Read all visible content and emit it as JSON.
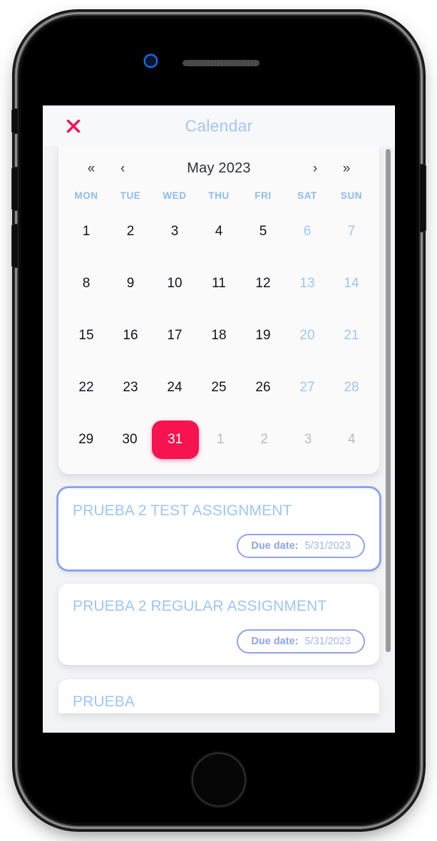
{
  "app": {
    "title": "Calendar",
    "close_icon": "close-x-icon",
    "accent_pink": "#f6134f",
    "accent_blue": "#9dc6f6",
    "accent_periwinkle": "#8ea4ee"
  },
  "calendar": {
    "month_label": "May 2023",
    "nav": {
      "prev_year": "«",
      "prev_month": "‹",
      "next_month": "›",
      "next_year": "»"
    },
    "weekdays": [
      "MON",
      "TUE",
      "WED",
      "THU",
      "FRI",
      "SAT",
      "SUN"
    ],
    "weeks": [
      [
        {
          "day": "1",
          "kind": "weekday"
        },
        {
          "day": "2",
          "kind": "weekday"
        },
        {
          "day": "3",
          "kind": "weekday"
        },
        {
          "day": "4",
          "kind": "weekday"
        },
        {
          "day": "5",
          "kind": "weekday"
        },
        {
          "day": "6",
          "kind": "weekend"
        },
        {
          "day": "7",
          "kind": "weekend"
        }
      ],
      [
        {
          "day": "8",
          "kind": "weekday"
        },
        {
          "day": "9",
          "kind": "weekday"
        },
        {
          "day": "10",
          "kind": "weekday"
        },
        {
          "day": "11",
          "kind": "weekday"
        },
        {
          "day": "12",
          "kind": "weekday"
        },
        {
          "day": "13",
          "kind": "weekend"
        },
        {
          "day": "14",
          "kind": "weekend"
        }
      ],
      [
        {
          "day": "15",
          "kind": "weekday"
        },
        {
          "day": "16",
          "kind": "weekday"
        },
        {
          "day": "17",
          "kind": "weekday"
        },
        {
          "day": "18",
          "kind": "weekday"
        },
        {
          "day": "19",
          "kind": "weekday"
        },
        {
          "day": "20",
          "kind": "weekend"
        },
        {
          "day": "21",
          "kind": "weekend"
        }
      ],
      [
        {
          "day": "22",
          "kind": "weekday"
        },
        {
          "day": "23",
          "kind": "weekday"
        },
        {
          "day": "24",
          "kind": "weekday"
        },
        {
          "day": "25",
          "kind": "weekday"
        },
        {
          "day": "26",
          "kind": "weekday"
        },
        {
          "day": "27",
          "kind": "weekend"
        },
        {
          "day": "28",
          "kind": "weekend"
        }
      ],
      [
        {
          "day": "29",
          "kind": "weekday"
        },
        {
          "day": "30",
          "kind": "weekday"
        },
        {
          "day": "31",
          "kind": "selected"
        },
        {
          "day": "1",
          "kind": "other-month"
        },
        {
          "day": "2",
          "kind": "other-month"
        },
        {
          "day": "3",
          "kind": "other-month"
        },
        {
          "day": "4",
          "kind": "other-month"
        }
      ]
    ]
  },
  "assignments": [
    {
      "title": "PRUEBA 2 TEST ASSIGNMENT",
      "due_label": "Due date:",
      "due_value": "5/31/2023",
      "selected": true,
      "truncated": false
    },
    {
      "title": "PRUEBA 2 REGULAR ASSIGNMENT",
      "due_label": "Due date:",
      "due_value": "5/31/2023",
      "selected": false,
      "truncated": false
    },
    {
      "title": "PRUEBA",
      "due_label": "",
      "due_value": "",
      "selected": false,
      "truncated": true
    }
  ],
  "device": {
    "camera_icon": "front-camera-icon",
    "speaker_icon": "earpiece-speaker-icon",
    "home_button_icon": "home-button-icon"
  }
}
